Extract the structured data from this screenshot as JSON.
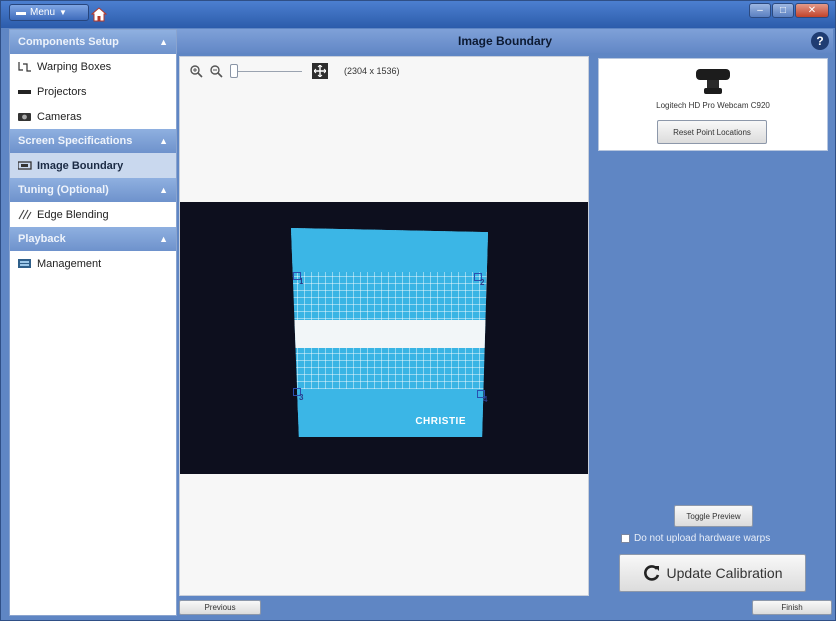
{
  "titlebar": {
    "menu_label": "Menu"
  },
  "sidebar": {
    "sections": [
      {
        "title": "Components Setup",
        "items": [
          {
            "label": "Warping Boxes"
          },
          {
            "label": "Projectors"
          },
          {
            "label": "Cameras"
          }
        ]
      },
      {
        "title": "Screen Specifications",
        "items": [
          {
            "label": "Image Boundary"
          }
        ]
      },
      {
        "title": "Tuning (Optional)",
        "items": [
          {
            "label": "Edge Blending"
          }
        ]
      },
      {
        "title": "Playback",
        "items": [
          {
            "label": "Management"
          }
        ]
      }
    ],
    "selected": "Image Boundary"
  },
  "main": {
    "title": "Image Boundary",
    "resolution": "(2304 x 1536)",
    "screen_brand": "CHRISTIE",
    "markers": [
      "1",
      "2",
      "3",
      "4"
    ]
  },
  "right_panel": {
    "camera_name": "Logitech HD Pro Webcam C920",
    "reset_button": "Reset Point Locations",
    "toggle_button": "Toggle Preview",
    "checkbox_label": "Do not upload hardware warps",
    "update_button": "Update Calibration"
  },
  "footer": {
    "previous": "Previous",
    "finish": "Finish"
  },
  "colors": {
    "chrome": "#5f86c4",
    "section_header": "#7fa1d8",
    "screen": "#39b4e4"
  }
}
